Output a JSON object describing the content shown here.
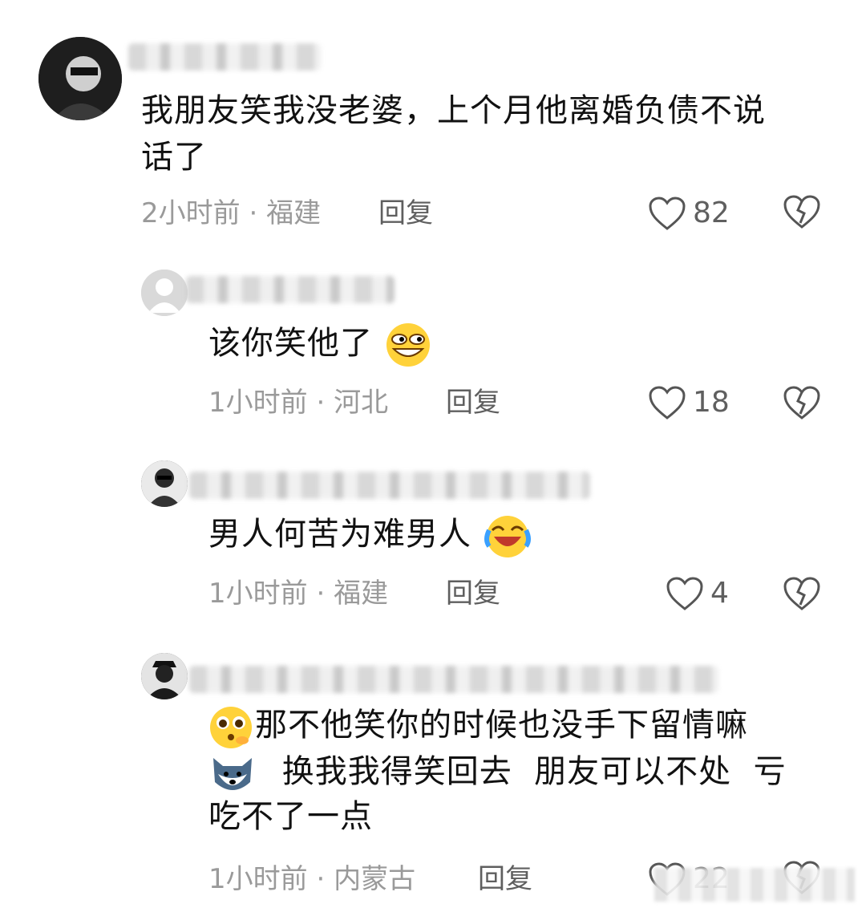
{
  "comments": [
    {
      "text_lines": [
        "我朋友笑我没老婆，上个月他离婚负债不说",
        "话了"
      ],
      "time": "2小时前",
      "location": "福建",
      "reply_label": "回复",
      "likes": "82"
    },
    {
      "text": "该你笑他了",
      "time": "1小时前",
      "location": "河北",
      "reply_label": "回复",
      "likes": "18"
    },
    {
      "text": "男人何苦为难男人",
      "time": "1小时前",
      "location": "福建",
      "reply_label": "回复",
      "likes": "4"
    },
    {
      "line1": "那不他笑你的时候也没手下留情嘛",
      "line2": "换我我得笑回去  朋友可以不处  亏",
      "line3": "吃不了一点",
      "time": "1小时前",
      "location": "内蒙古",
      "reply_label": "回复",
      "likes": "22"
    }
  ],
  "separator": "·",
  "icons": {
    "like": "heart-outline-icon",
    "dislike": "broken-heart-icon",
    "emoji_grin": "grinning-emoji-icon",
    "emoji_cry": "crying-laughing-emoji-icon",
    "emoji_plead": "pleading-emoji-icon",
    "emoji_doge": "doge-emoji-icon"
  }
}
